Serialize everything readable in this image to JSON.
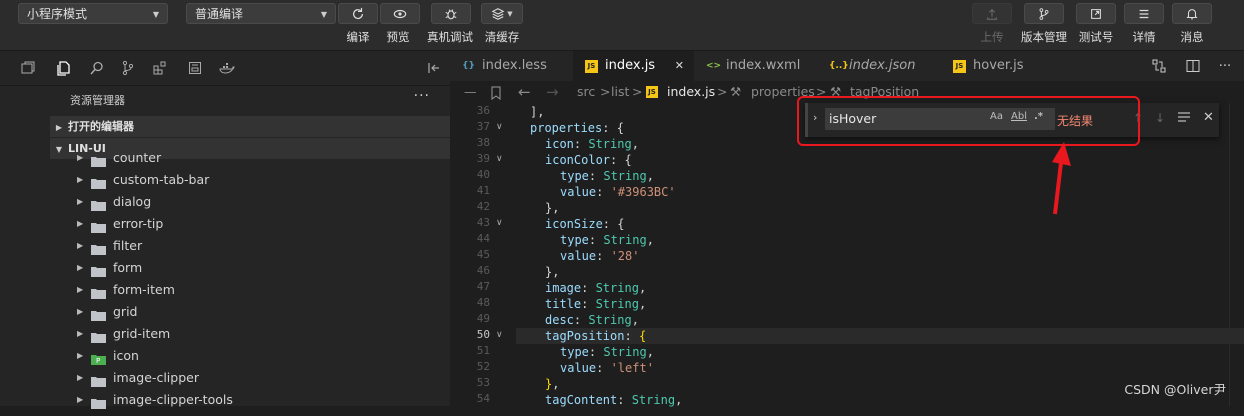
{
  "toolbar": {
    "mode_select": "小程序模式",
    "compile_select": "普通编译",
    "buttons_left": [
      {
        "label": "编译",
        "icon": "refresh-icon"
      },
      {
        "label": "预览",
        "icon": "eye-icon"
      },
      {
        "label": "真机调试",
        "icon": "bug-icon"
      },
      {
        "label": "清缓存",
        "icon": "layers-icon"
      }
    ],
    "buttons_right": [
      {
        "label": "上传",
        "icon": "upload-icon",
        "disabled": true
      },
      {
        "label": "版本管理",
        "icon": "branch-icon"
      },
      {
        "label": "测试号",
        "icon": "external-link-icon"
      },
      {
        "label": "详情",
        "icon": "menu-icon"
      },
      {
        "label": "消息",
        "icon": "bell-icon"
      }
    ]
  },
  "explorer": {
    "title": "资源管理器",
    "more": "···",
    "open_editors": "打开的编辑器",
    "project": "LIN-UI",
    "items": [
      {
        "name": "counter",
        "special": false
      },
      {
        "name": "custom-tab-bar",
        "special": false
      },
      {
        "name": "dialog",
        "special": false
      },
      {
        "name": "error-tip",
        "special": false
      },
      {
        "name": "filter",
        "special": false
      },
      {
        "name": "form",
        "special": false
      },
      {
        "name": "form-item",
        "special": false
      },
      {
        "name": "grid",
        "special": false
      },
      {
        "name": "grid-item",
        "special": false
      },
      {
        "name": "icon",
        "special": true
      },
      {
        "name": "image-clipper",
        "special": false
      },
      {
        "name": "image-clipper-tools",
        "special": false
      }
    ]
  },
  "tabs": [
    {
      "name": "index.less",
      "icon": "{}",
      "color": "#519aba",
      "active": false,
      "italic": false
    },
    {
      "name": "index.js",
      "icon": "JS",
      "color": "#f5c518",
      "active": true,
      "italic": false
    },
    {
      "name": "index.wxml",
      "icon": "<>",
      "color": "#8dc149",
      "active": false,
      "italic": false
    },
    {
      "name": "index.json",
      "icon": "{..}",
      "color": "#f5c518",
      "active": false,
      "italic": true
    },
    {
      "name": "hover.js",
      "icon": "JS",
      "color": "#f5c518",
      "active": false,
      "italic": false
    }
  ],
  "breadcrumb": [
    "src",
    "list",
    "index.js",
    "properties",
    "tagPosition"
  ],
  "editor": {
    "current_line": 50,
    "lines": [
      {
        "n": 36,
        "fold": false,
        "indent": 1,
        "tokens": [
          [
            "p",
            "],"
          ]
        ]
      },
      {
        "n": 37,
        "fold": true,
        "indent": 1,
        "tokens": [
          [
            "k",
            "properties"
          ],
          [
            "p",
            ": {"
          ]
        ]
      },
      {
        "n": 38,
        "fold": false,
        "indent": 2,
        "tokens": [
          [
            "k",
            "icon"
          ],
          [
            "p",
            ": "
          ],
          [
            "t",
            "String"
          ],
          [
            "p",
            ","
          ]
        ]
      },
      {
        "n": 39,
        "fold": true,
        "indent": 2,
        "tokens": [
          [
            "k",
            "iconColor"
          ],
          [
            "p",
            ": {"
          ]
        ]
      },
      {
        "n": 40,
        "fold": false,
        "indent": 3,
        "tokens": [
          [
            "k",
            "type"
          ],
          [
            "p",
            ": "
          ],
          [
            "t",
            "String"
          ],
          [
            "p",
            ","
          ]
        ]
      },
      {
        "n": 41,
        "fold": false,
        "indent": 3,
        "tokens": [
          [
            "k",
            "value"
          ],
          [
            "p",
            ": "
          ],
          [
            "s",
            "'#3963BC'"
          ]
        ]
      },
      {
        "n": 42,
        "fold": false,
        "indent": 2,
        "tokens": [
          [
            "p",
            "},"
          ]
        ]
      },
      {
        "n": 43,
        "fold": true,
        "indent": 2,
        "tokens": [
          [
            "k",
            "iconSize"
          ],
          [
            "p",
            ": {"
          ]
        ]
      },
      {
        "n": 44,
        "fold": false,
        "indent": 3,
        "tokens": [
          [
            "k",
            "type"
          ],
          [
            "p",
            ": "
          ],
          [
            "t",
            "String"
          ],
          [
            "p",
            ","
          ]
        ]
      },
      {
        "n": 45,
        "fold": false,
        "indent": 3,
        "tokens": [
          [
            "k",
            "value"
          ],
          [
            "p",
            ": "
          ],
          [
            "s",
            "'28'"
          ]
        ]
      },
      {
        "n": 46,
        "fold": false,
        "indent": 2,
        "tokens": [
          [
            "p",
            "},"
          ]
        ]
      },
      {
        "n": 47,
        "fold": false,
        "indent": 2,
        "tokens": [
          [
            "k",
            "image"
          ],
          [
            "p",
            ": "
          ],
          [
            "t",
            "String"
          ],
          [
            "p",
            ","
          ]
        ]
      },
      {
        "n": 48,
        "fold": false,
        "indent": 2,
        "tokens": [
          [
            "k",
            "title"
          ],
          [
            "p",
            ": "
          ],
          [
            "t",
            "String"
          ],
          [
            "p",
            ","
          ]
        ]
      },
      {
        "n": 49,
        "fold": false,
        "indent": 2,
        "tokens": [
          [
            "k",
            "desc"
          ],
          [
            "p",
            ": "
          ],
          [
            "t",
            "String"
          ],
          [
            "p",
            ","
          ]
        ]
      },
      {
        "n": 50,
        "fold": true,
        "indent": 2,
        "tokens": [
          [
            "k",
            "tagPosition"
          ],
          [
            "p",
            ": "
          ],
          [
            "b",
            "{"
          ]
        ]
      },
      {
        "n": 51,
        "fold": false,
        "indent": 3,
        "tokens": [
          [
            "k",
            "type"
          ],
          [
            "p",
            ": "
          ],
          [
            "t",
            "String"
          ],
          [
            "p",
            ","
          ]
        ]
      },
      {
        "n": 52,
        "fold": false,
        "indent": 3,
        "tokens": [
          [
            "k",
            "value"
          ],
          [
            "p",
            ": "
          ],
          [
            "s",
            "'left'"
          ]
        ]
      },
      {
        "n": 53,
        "fold": false,
        "indent": 2,
        "tokens": [
          [
            "b",
            "}"
          ],
          [
            "p",
            ","
          ]
        ]
      },
      {
        "n": 54,
        "fold": false,
        "indent": 2,
        "tokens": [
          [
            "k",
            "tagContent"
          ],
          [
            "p",
            ": "
          ],
          [
            "t",
            "String"
          ],
          [
            "p",
            ","
          ]
        ]
      }
    ]
  },
  "find_widget": {
    "query": "isHover",
    "match_case": "Aa",
    "whole_word": "Abl",
    "regex": ".*",
    "result": "无结果"
  },
  "watermark": "CSDN @Oliver尹",
  "colors": {
    "annotation": "#e8181e",
    "no_result": "#f48771"
  }
}
